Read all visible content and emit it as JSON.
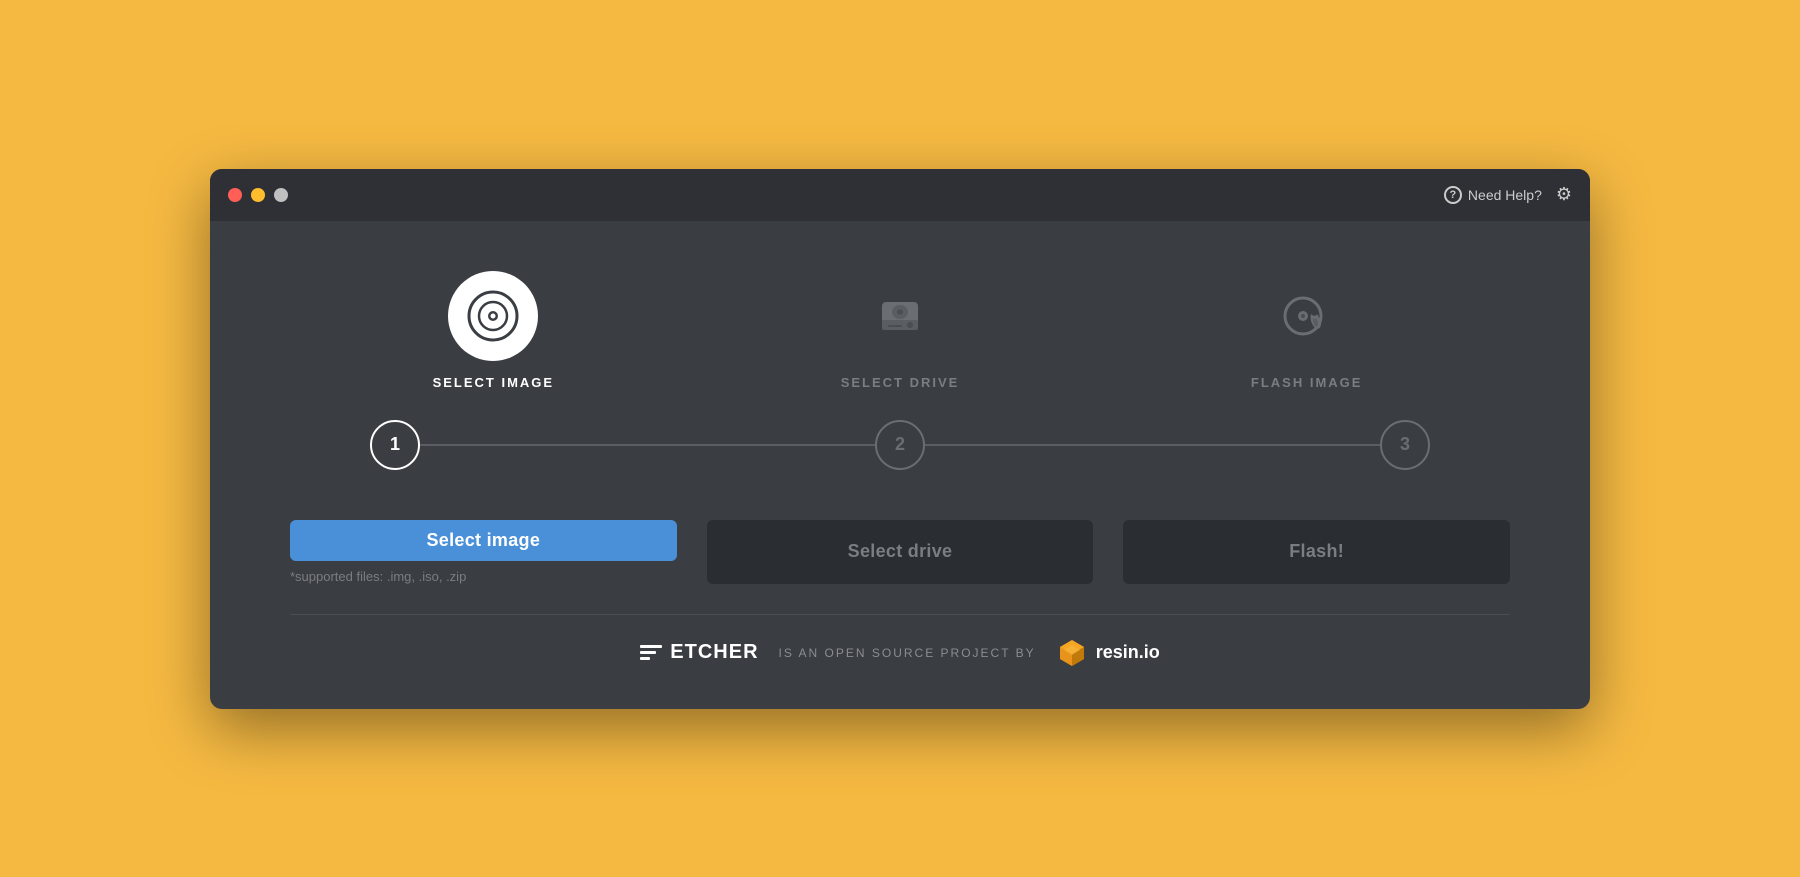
{
  "window": {
    "traffic_lights": [
      "close",
      "minimize",
      "maximize"
    ],
    "help_label": "Need Help?",
    "settings_icon": "⚙"
  },
  "steps": [
    {
      "id": "select-image",
      "number": "1",
      "label": "SELECT IMAGE",
      "state": "active",
      "icon": "disc-icon"
    },
    {
      "id": "select-drive",
      "number": "2",
      "label": "SELECT DRIVE",
      "state": "inactive",
      "icon": "drive-icon"
    },
    {
      "id": "flash-image",
      "number": "3",
      "label": "FLASH IMAGE",
      "state": "inactive",
      "icon": "flash-icon"
    }
  ],
  "buttons": [
    {
      "id": "select-image-btn",
      "label": "Select image",
      "style": "primary",
      "enabled": true
    },
    {
      "id": "select-drive-btn",
      "label": "Select drive",
      "style": "secondary",
      "enabled": false
    },
    {
      "id": "flash-btn",
      "label": "Flash!",
      "style": "secondary",
      "enabled": false
    }
  ],
  "supported_files_text": "*supported files: .img, .iso, .zip",
  "footer": {
    "tagline": "IS AN OPEN SOURCE PROJECT BY",
    "brand": "resin.io",
    "etcher_label": "ETCHER"
  }
}
